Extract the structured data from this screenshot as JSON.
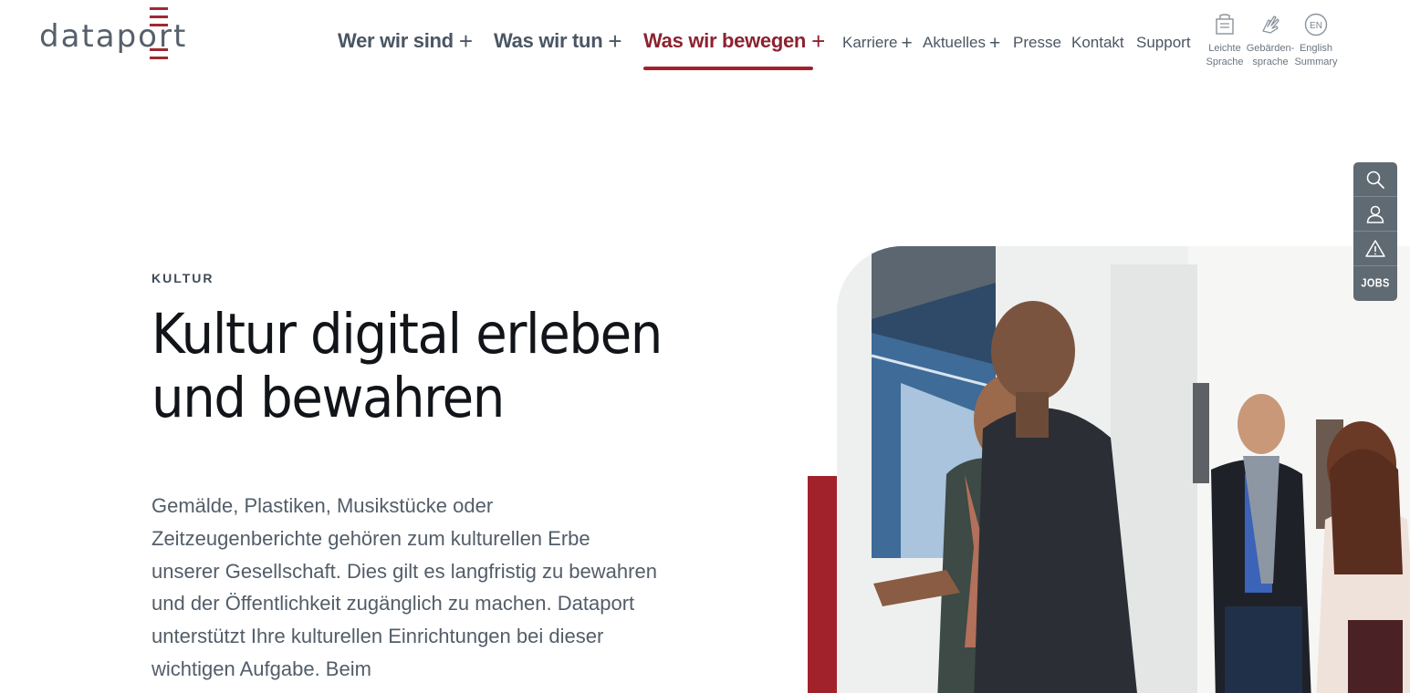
{
  "header": {
    "logo_text": "dataport",
    "nav_main": [
      {
        "label": "Wer wir sind",
        "expand": "+"
      },
      {
        "label": "Was wir tun",
        "expand": "+"
      },
      {
        "label": "Was wir bewegen",
        "expand": "+",
        "active": true
      }
    ],
    "nav_secondary": [
      {
        "label": "Karriere",
        "expand": "+"
      },
      {
        "label": "Aktuelles",
        "expand": "+"
      },
      {
        "label": "Presse"
      },
      {
        "label": "Kontakt"
      },
      {
        "label": "Support"
      }
    ],
    "utility": [
      {
        "line1": "Leichte",
        "line2": "Sprache",
        "icon": "easy-language-icon"
      },
      {
        "line1": "Gebärden-",
        "line2": "sprache",
        "icon": "sign-language-icon"
      },
      {
        "line1": "English",
        "line2": "Summary",
        "icon": "en-language-icon",
        "badge": "EN"
      }
    ]
  },
  "hero": {
    "eyebrow": "KULTUR",
    "headline_line1": "Kultur digital erleben",
    "headline_line2": "und bewahren",
    "body": "Gemälde, Plastiken, Musikstücke oder Zeitzeugenberichte gehören zum kulturellen Erbe unserer Gesellschaft. Dies gilt es langfristig zu bewahren und der Öffentlichkeit zugänglich zu machen. Dataport unterstützt Ihre kulturellen Einrichtungen bei dieser wichtigen Aufgabe. Beim"
  },
  "sidebar": [
    {
      "icon": "search-icon"
    },
    {
      "icon": "user-icon"
    },
    {
      "icon": "warning-icon"
    },
    {
      "label": "JOBS"
    }
  ],
  "colors": {
    "brand_red": "#a2222c",
    "active_nav": "#8c2230",
    "text_dark": "#111418",
    "text_muted": "#525d69",
    "sidebar_bg": "#5f6a73"
  }
}
